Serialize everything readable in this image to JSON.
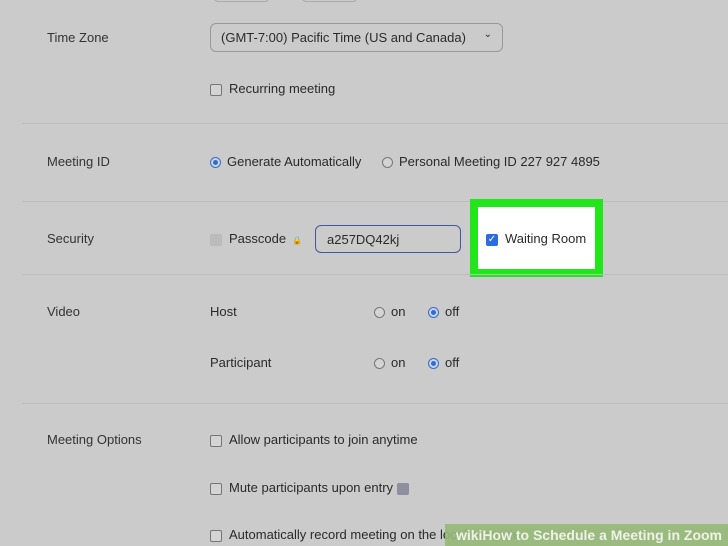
{
  "time_zone": {
    "label": "Time Zone",
    "value": "(GMT-7:00) Pacific Time (US and Canada)"
  },
  "recurring": {
    "label": "Recurring meeting"
  },
  "meeting_id": {
    "label": "Meeting ID",
    "auto": "Generate Automatically",
    "personal": "Personal Meeting ID 227 927 4895"
  },
  "security": {
    "label": "Security",
    "passcode_label": "Passcode",
    "passcode_value": "a257DQ42kj",
    "waiting_room": "Waiting Room"
  },
  "video": {
    "label": "Video",
    "host": "Host",
    "participant": "Participant",
    "on": "on",
    "off": "off"
  },
  "options": {
    "label": "Meeting Options",
    "allow_join": "Allow participants to join anytime",
    "mute": "Mute participants upon entry",
    "record": "Automatically record meeting on the local computer"
  },
  "watermark": "wikiHow to Schedule a Meeting in Zoom",
  "colors": {
    "accent": "#2d6cdf",
    "highlight": "#22e51c",
    "background": "#cbcbcb"
  }
}
